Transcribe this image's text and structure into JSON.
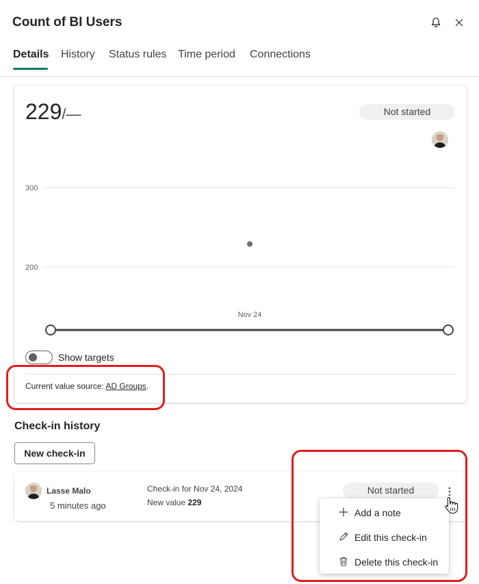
{
  "header": {
    "title": "Count of BI Users"
  },
  "tabs": [
    {
      "label": "Details"
    },
    {
      "label": "History"
    },
    {
      "label": "Status rules"
    },
    {
      "label": "Time period"
    },
    {
      "label": "Connections"
    }
  ],
  "summary": {
    "current_value": "229",
    "target_separator": "/—",
    "status": "Not started"
  },
  "chart_data": {
    "type": "scatter",
    "x": [
      "Nov 24"
    ],
    "y": [
      229
    ],
    "ylim": [
      180,
      320
    ],
    "ytick_labels": [
      "300",
      "200"
    ],
    "xtick_labels": [
      "Nov 24"
    ],
    "grid": true
  },
  "controls": {
    "show_targets_label": "Show targets",
    "show_targets_on": false
  },
  "source": {
    "prefix": "Current value source: ",
    "link": "AD Groups",
    "suffix": "."
  },
  "history": {
    "title": "Check-in history",
    "new_button": "New check-in",
    "entries": [
      {
        "user": "Lasse Malo",
        "time": "5 minutes ago",
        "checkin_label": "Check-in for Nov 24, 2024",
        "new_value_label": "New value",
        "new_value": "229",
        "status": "Not started"
      }
    ]
  },
  "context_menu": {
    "items": [
      {
        "label": "Add a note",
        "icon": "plus-icon"
      },
      {
        "label": "Edit this check-in",
        "icon": "pencil-icon"
      },
      {
        "label": "Delete this check-in",
        "icon": "trash-icon"
      }
    ]
  },
  "colors": {
    "accent": "#117865",
    "highlight": "#e31b1b",
    "pill_bg": "#f0f0f0"
  }
}
